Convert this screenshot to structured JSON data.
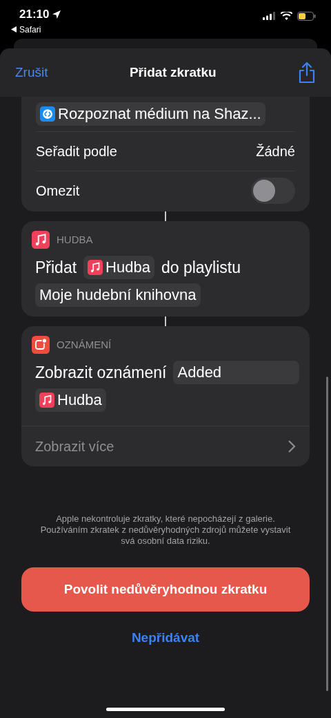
{
  "status_bar": {
    "time": "21:10",
    "back_label": "Safari"
  },
  "header": {
    "cancel": "Zrušit",
    "title": "Přidat zkratku"
  },
  "actions": [
    {
      "kind": "settings",
      "token": {
        "kind": "shazam_token",
        "text": "Rozpoznat médium na Shaz..."
      },
      "rows": [
        {
          "kind": "value",
          "label": "Seřadit podle",
          "value": "Žádné"
        },
        {
          "kind": "toggle",
          "label": "Omezit",
          "on": false
        }
      ]
    },
    {
      "kind": "music_action",
      "category": "HUDBA",
      "parts": [
        {
          "kind": "text",
          "text": "Přidat"
        },
        {
          "kind": "music_token",
          "text": "Hudba"
        },
        {
          "kind": "text",
          "text": "do playlistu"
        },
        {
          "kind": "token",
          "text": "Moje hudební knihovna"
        }
      ]
    },
    {
      "kind": "notification_action",
      "category": "OZNÁMENÍ",
      "parts": [
        {
          "kind": "text",
          "text": "Zobrazit oznámení"
        },
        {
          "kind": "wide_token",
          "text": "Added"
        },
        {
          "kind": "music_token",
          "text": "Hudba"
        }
      ],
      "more": "Zobrazit více"
    }
  ],
  "notice": "Apple nekontroluje zkratky, které nepocházejí z galerie. Používáním zkratek z nedůvěryhodných zdrojů můžete vystavit svá osobní data riziku.",
  "primary_button": "Povolit nedůvěryhodnou zkratku",
  "secondary_button": "Nepřidávat"
}
